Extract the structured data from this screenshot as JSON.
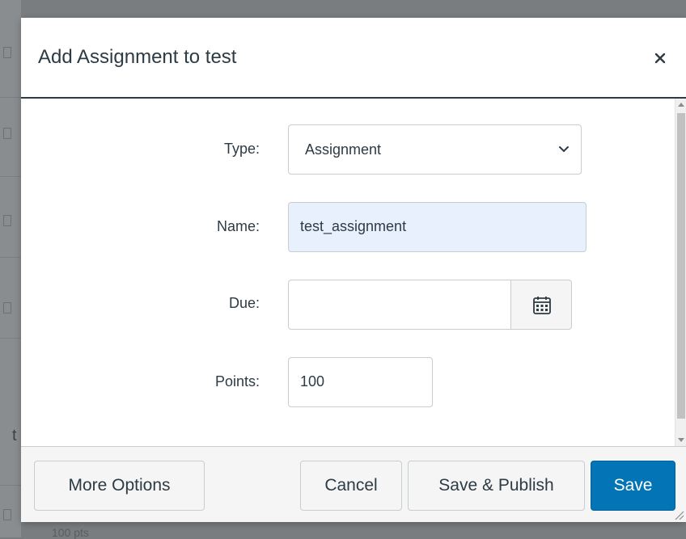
{
  "modal": {
    "title": "Add Assignment to test"
  },
  "form": {
    "type_label": "Type:",
    "type_value": "Assignment",
    "name_label": "Name:",
    "name_value": "test_assignment",
    "due_label": "Due:",
    "due_value": "",
    "points_label": "Points:",
    "points_value": "100"
  },
  "footer": {
    "more_options": "More Options",
    "cancel": "Cancel",
    "save_publish": "Save & Publish",
    "save": "Save"
  },
  "background": {
    "t_fragment": "t",
    "pts_fragment": "100 pts"
  },
  "colors": {
    "primary": "#0374b5",
    "text": "#2d3b45",
    "autofill": "#e8f0fe"
  },
  "icons": {
    "close": "close-icon",
    "chevron": "chevron-down-icon",
    "calendar": "calendar-icon"
  }
}
